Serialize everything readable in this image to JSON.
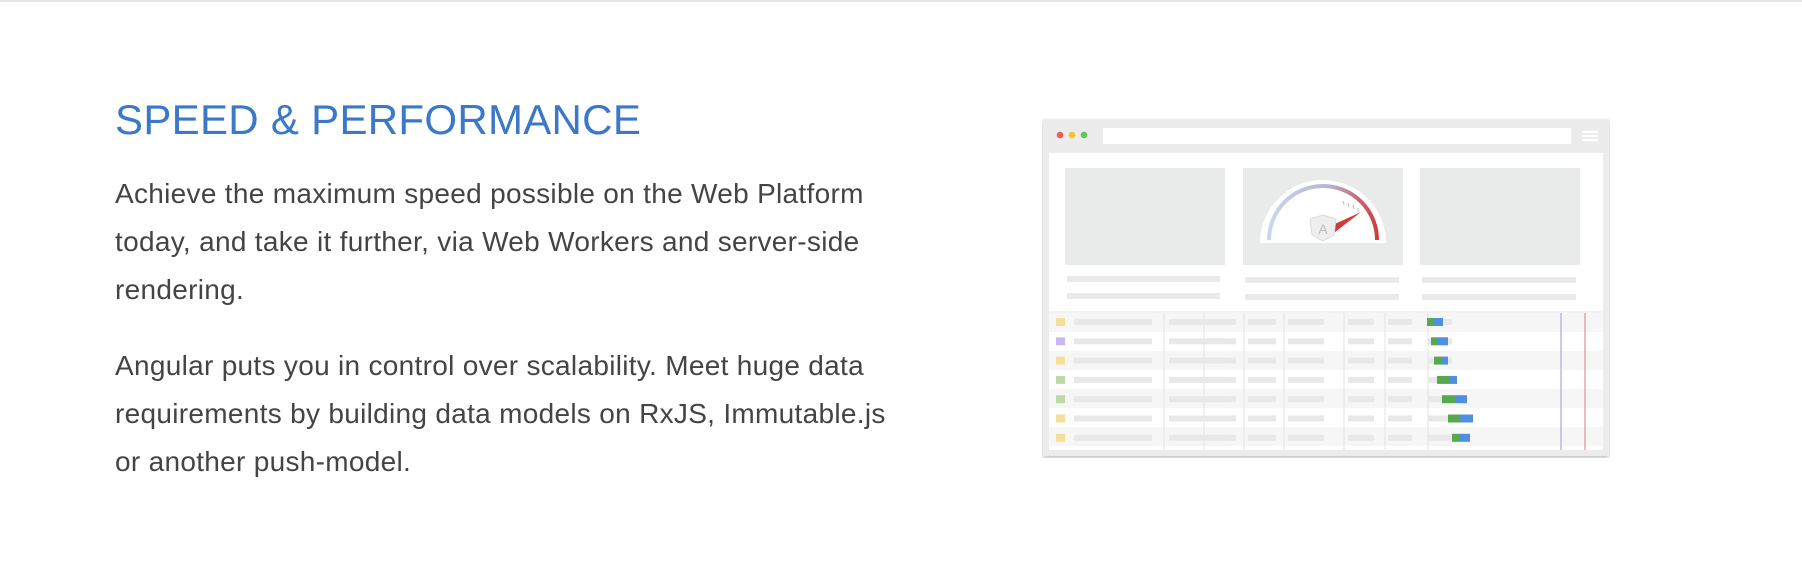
{
  "section": {
    "title": "SPEED & PERFORMANCE",
    "paragraph_1": "Achieve the maximum speed possible on the Web Platform today, and take it further, via Web Workers and server-side rendering.",
    "paragraph_2": "Angular puts you in control over scalability. Meet huge data requirements by building data models on RxJS, Immutable.js or another push-model."
  },
  "illustration": {
    "gauge_logo_letter": "A",
    "colors": {
      "title": "#3b78c9",
      "text": "#444444",
      "window_chrome": "#e8e9e8",
      "placeholder": "#e9eaea",
      "gauge_red": "#d33b3b",
      "bar_green": "#56a94f",
      "bar_blue": "#4f8fe0",
      "dot_red": "#ee5c54",
      "dot_yellow": "#f6bf2b",
      "dot_green": "#62c655"
    },
    "timeline_row_markers": [
      "#f6df9a",
      "#c9b8ee",
      "#f6df9a",
      "#bfd8a8",
      "#bfd8a8",
      "#f6df9a",
      "#f6df9a"
    ]
  }
}
